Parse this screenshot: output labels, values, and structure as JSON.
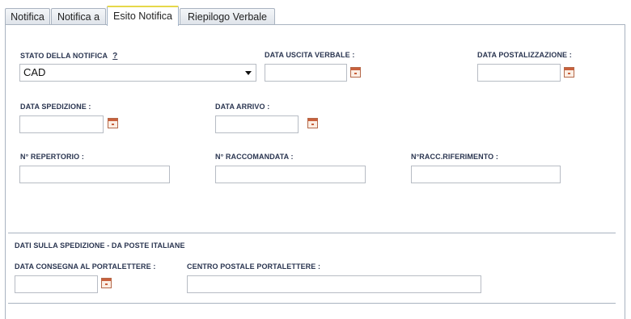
{
  "tabs": [
    "Notifica",
    "Notifica a",
    "Esito Notifica",
    "Riepilogo Verbale"
  ],
  "active_tab": "Esito Notifica",
  "fields": {
    "stato_notifica": {
      "label": "STATO DELLA NOTIFICA",
      "help": "?",
      "value": "CAD"
    },
    "data_uscita_verbale": {
      "label": "DATA USCITA VERBALE :",
      "value": ""
    },
    "data_postalizzazione": {
      "label": "DATA POSTALIZZAZIONE :",
      "value": ""
    },
    "data_spedizione": {
      "label": "DATA SPEDIZIONE :",
      "value": ""
    },
    "data_arrivo": {
      "label": "DATA ARRIVO :",
      "value": ""
    },
    "n_repertorio": {
      "label": "N° REPERTORIO :",
      "value": ""
    },
    "n_raccomandata": {
      "label": "N° RACCOMANDATA :",
      "value": ""
    },
    "n_racc_riferimento": {
      "label": "N°RACC.RIFERIMENTO :",
      "value": ""
    }
  },
  "section_spedizione": {
    "title": "DATI SULLA SPEDIZIONE - DA POSTE ITALIANE",
    "data_consegna": {
      "label": "DATA CONSEGNA AL PORTALETTERE :",
      "value": ""
    },
    "centro_postale": {
      "label": "CENTRO POSTALE PORTALETTERE :",
      "value": ""
    }
  },
  "icons": {
    "calendar": "calendar-icon",
    "dropdown": "chevron-down-icon"
  }
}
